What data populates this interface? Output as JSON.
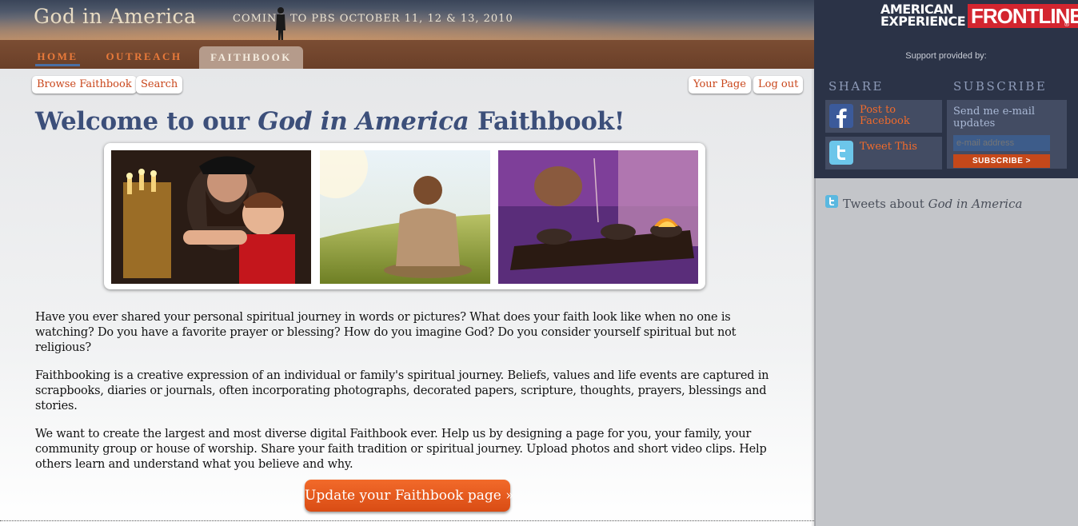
{
  "header": {
    "site_title_part1": "God in",
    "site_title_part2": "America",
    "tagline": "COMING TO PBS OCTOBER 11, 12 & 13, 2010"
  },
  "nav": {
    "items": [
      {
        "label": "HOME"
      },
      {
        "label": "OUTREACH"
      },
      {
        "label": "FAITHBOOK"
      }
    ],
    "active": "FAITHBOOK"
  },
  "sponsors": {
    "ae_line1": "AMERICAN",
    "ae_line2": "EXPERIENCE",
    "frontline": "FRONTLINE",
    "registered": "®",
    "support_text": "Support provided by:"
  },
  "toolbar": {
    "browse_label": "Browse Faithbook",
    "search_label": "Search",
    "your_page_label": "Your Page",
    "logout_label": "Log out"
  },
  "main": {
    "welcome_before": "Welcome to our ",
    "welcome_italic": "God in America",
    "welcome_after": " Faithbook!",
    "paragraphs": [
      "Have you ever shared your personal spiritual journey in words or pictures? What does your faith look like when no one is watching? Do you have a favorite prayer or blessing? How do you imagine God? Do you consider yourself spiritual but not religious?",
      "Faithbooking is a creative expression of an individual or family's spiritual journey. Beliefs, values and life events are captured in scrapbooks, diaries or journals, often incorporating photographs, decorated papers, scripture, thoughts, prayers, blessings and stories.",
      "We want to create the largest and most diverse digital Faithbook ever. Help us by designing a page for you, your family, your community group or house of worship. Share your faith tradition or spiritual journey. Upload photos and short video clips. Help others learn and understand what you believe and why."
    ],
    "cta_label": "Update your Faithbook page »"
  },
  "sidebar": {
    "share_heading": "SHARE",
    "subscribe_heading": "SUBSCRIBE",
    "facebook_label": "Post to Facebook",
    "twitter_label": "Tweet This",
    "subscribe_text": "Send me e-mail updates",
    "email_placeholder": "e-mail address",
    "subscribe_button": "SUBSCRIBE >",
    "tweets_before": "Tweets about ",
    "tweets_italic": "God in America"
  },
  "colors": {
    "accent_orange": "#f26b2b",
    "title_blue": "#3c4f7a",
    "sidebar_dark": "#2b3347",
    "frontline_red": "#d3252f"
  }
}
